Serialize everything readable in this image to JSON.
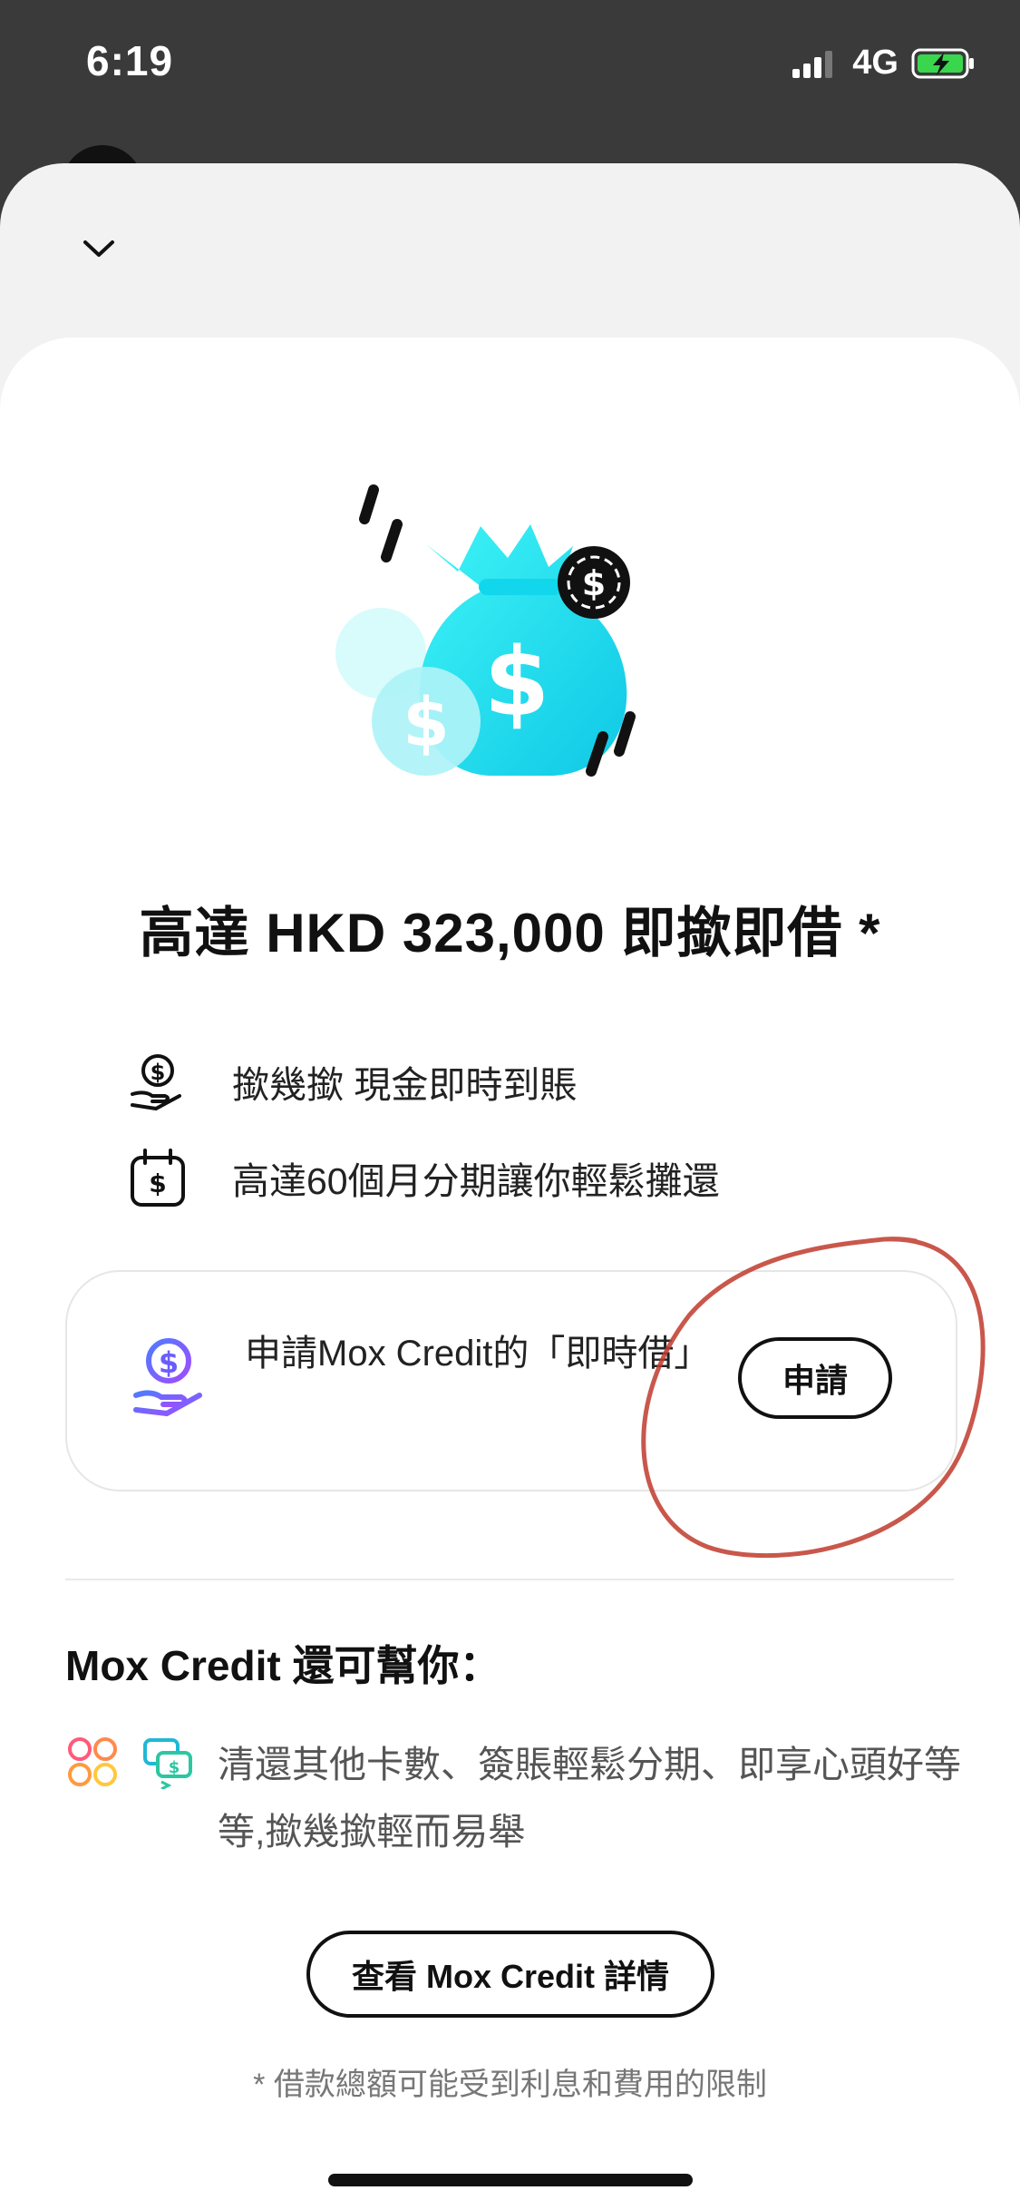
{
  "status_bar": {
    "time": "6:19",
    "network": "4G"
  },
  "hero": {
    "headline": "高達 HKD 323,000  即撳即借 *"
  },
  "features": [
    {
      "icon": "cash-hand-icon",
      "text": "撳幾撳 現金即時到賬"
    },
    {
      "icon": "calendar-dollar-icon",
      "text": "高達60個月分期讓你輕鬆攤還"
    }
  ],
  "apply_card": {
    "text": "申請Mox Credit的「即時借」",
    "button": "申請"
  },
  "more": {
    "title": "Mox Credit 還可幫你：",
    "text": "清還其他卡數、簽賬輕鬆分期、即享心頭好等等,撳幾撳輕而易舉"
  },
  "details_button": "查看 Mox Credit 詳情",
  "footnote": "* 借款總額可能受到利息和費用的限制",
  "colors": {
    "accent_cyan": "#1fe3ef",
    "purple": "#7b4dff",
    "annotation_red": "#c0392b"
  }
}
